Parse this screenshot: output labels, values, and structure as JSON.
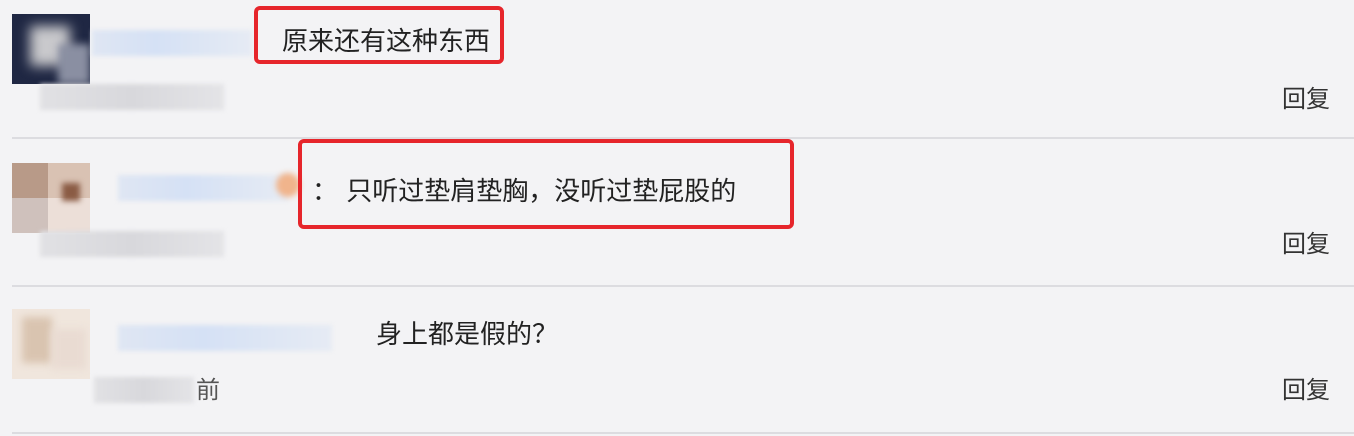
{
  "comments": [
    {
      "text": "原来还有这种东西",
      "reply_label": "回复",
      "highlighted": true
    },
    {
      "text": "：  只听过垫肩垫胸，没听过垫屁股的",
      "reply_label": "回复",
      "highlighted": true
    },
    {
      "text": "身上都是假的？",
      "meta_suffix": "前",
      "reply_label": "回复",
      "highlighted": false
    }
  ],
  "colors": {
    "highlight": "#e6252b",
    "background": "#f3f3f5",
    "divider": "#dcdce0"
  }
}
